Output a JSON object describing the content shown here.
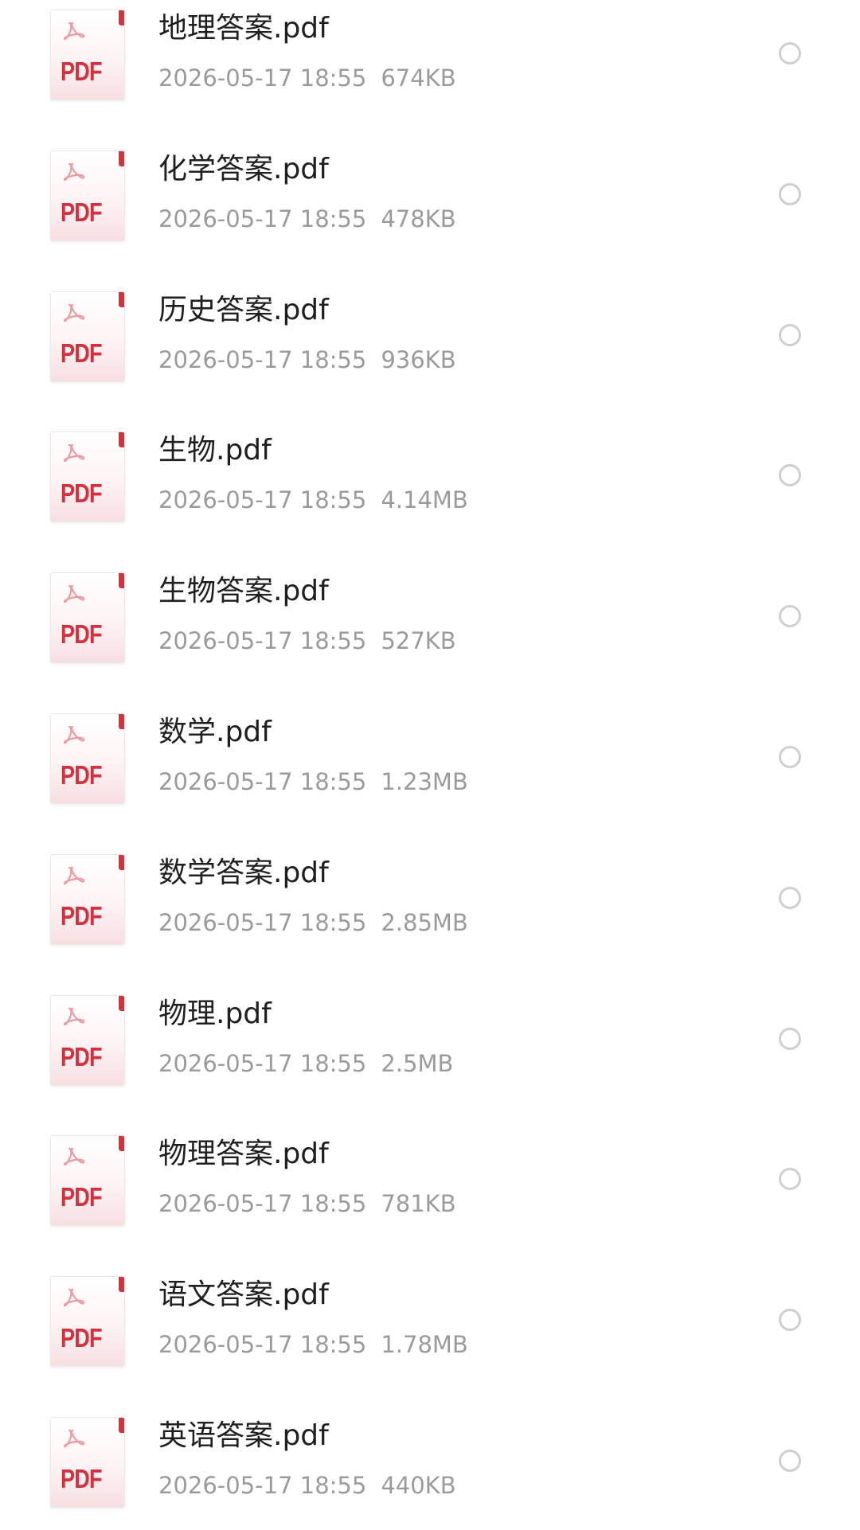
{
  "files": [
    {
      "name": "地理答案.pdf",
      "date": "2026-05-17 18:55",
      "size": "674KB",
      "icon": "pdf-file-icon"
    },
    {
      "name": "化学答案.pdf",
      "date": "2026-05-17 18:55",
      "size": "478KB",
      "icon": "pdf-file-icon"
    },
    {
      "name": "历史答案.pdf",
      "date": "2026-05-17 18:55",
      "size": "936KB",
      "icon": "pdf-file-icon"
    },
    {
      "name": "生物.pdf",
      "date": "2026-05-17 18:55",
      "size": "4.14MB",
      "icon": "pdf-file-icon"
    },
    {
      "name": "生物答案.pdf",
      "date": "2026-05-17 18:55",
      "size": "527KB",
      "icon": "pdf-file-icon"
    },
    {
      "name": "数学.pdf",
      "date": "2026-05-17 18:55",
      "size": "1.23MB",
      "icon": "pdf-file-icon"
    },
    {
      "name": "数学答案.pdf",
      "date": "2026-05-17 18:55",
      "size": "2.85MB",
      "icon": "pdf-file-icon"
    },
    {
      "name": "物理.pdf",
      "date": "2026-05-17 18:55",
      "size": "2.5MB",
      "icon": "pdf-file-icon"
    },
    {
      "name": "物理答案.pdf",
      "date": "2026-05-17 18:55",
      "size": "781KB",
      "icon": "pdf-file-icon"
    },
    {
      "name": "语文答案.pdf",
      "date": "2026-05-17 18:55",
      "size": "1.78MB",
      "icon": "pdf-file-icon"
    },
    {
      "name": "英语答案.pdf",
      "date": "2026-05-17 18:55",
      "size": "440KB",
      "icon": "pdf-file-icon"
    }
  ],
  "icon_label": "PDF",
  "colors": {
    "pdf_red": "#d23140",
    "name_text": "#1f1f1f",
    "meta_text": "#9b9b9b",
    "radio_border": "#cfcfcf"
  }
}
